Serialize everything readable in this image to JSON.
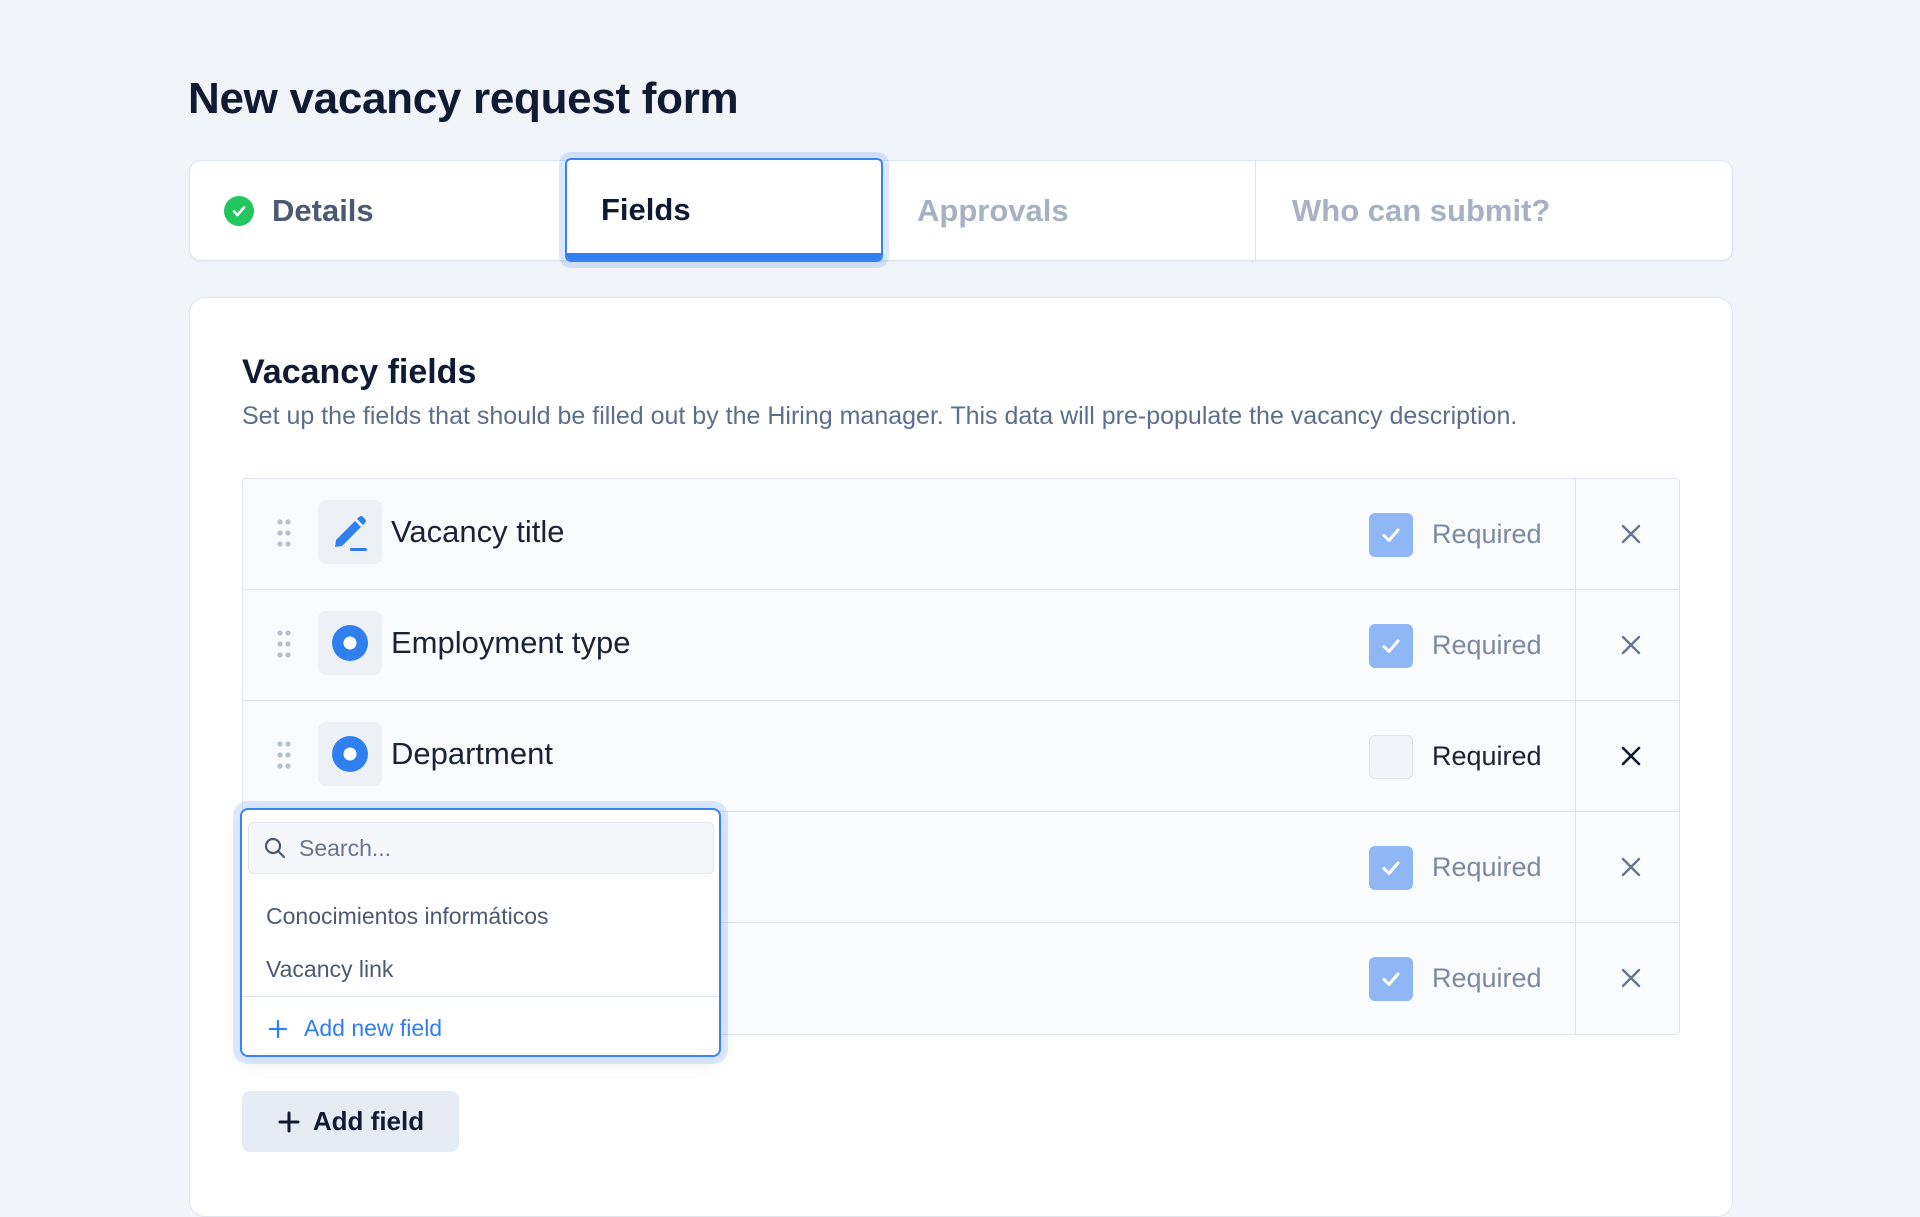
{
  "page": {
    "title": "New vacancy request form"
  },
  "tabs": [
    {
      "label": "Details",
      "status": "complete"
    },
    {
      "label": "Fields",
      "status": "active"
    },
    {
      "label": "Approvals",
      "status": "disabled"
    },
    {
      "label": "Who can submit?",
      "status": "disabled"
    }
  ],
  "section": {
    "title": "Vacancy fields",
    "description": "Set up the fields that should be filled out by the Hiring manager. This data will pre-populate the vacancy description."
  },
  "fields": [
    {
      "label": "Vacancy title",
      "icon": "pencil-icon",
      "required": true,
      "required_label": "Required"
    },
    {
      "label": "Employment type",
      "icon": "radio-icon",
      "required": true,
      "required_label": "Required"
    },
    {
      "label": "Department",
      "icon": "radio-icon",
      "required": false,
      "required_label": "Required"
    },
    {
      "label": "",
      "icon": "",
      "required": true,
      "required_label": "Required"
    },
    {
      "label": "",
      "icon": "",
      "required": true,
      "required_label": "Required"
    }
  ],
  "dropdown": {
    "search_placeholder": "Search...",
    "options": [
      "Conocimientos informáticos",
      "Vacancy link"
    ],
    "add_new_label": "Add new field"
  },
  "add_field_label": "Add field",
  "colors": {
    "accent": "#2f7ff0",
    "success": "#22c55e",
    "checkbox_checked": "#8fb7f5"
  }
}
